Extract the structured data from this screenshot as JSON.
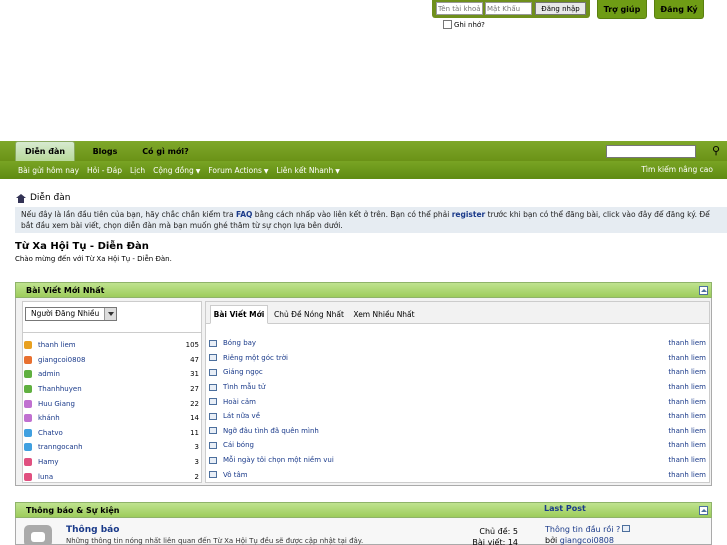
{
  "login": {
    "username_placeholder": "Tên tài khoả",
    "password_placeholder": "Mật Khẩu",
    "login_button": "Đăng nhập",
    "remember": "Ghi nhớ?"
  },
  "top_buttons": {
    "help": "Trợ giúp",
    "register": "Đăng Ký"
  },
  "nav": {
    "tabs": [
      "Diễn đàn",
      "Blogs",
      "Có gì mới?"
    ],
    "sub": [
      "Bài gửi hôm nay",
      "Hỏi - Đáp",
      "Lịch",
      "Cộng đồng",
      "Forum Actions",
      "Liên kết Nhanh"
    ],
    "advanced_search": "Tìm kiếm nâng cao"
  },
  "breadcrumb": "Diễn đàn",
  "notice": {
    "part1": "Nếu đây là lần đầu tiên của bạn, hãy chắc chắn kiểm tra ",
    "faq": "FAQ",
    "part2": " bằng cách nhấp vào liên kết ở trên. Bạn có thể phải ",
    "register": "register",
    "part3": " trước khi bạn có thể đăng bài, click vào đây để đăng ký. Để bắt đầu xem bài viết, chọn diễn đàn mà bạn muốn ghé thăm từ sự chọn lựa bên dưới."
  },
  "page": {
    "title": "Từ Xa Hội Tụ - Diễn Đàn",
    "description": "Chào mừng đến với Từ Xa Hội Tụ - Diễn Đàn."
  },
  "latest": {
    "heading": "Bài Viết Mới Nhất",
    "poster_select": "Người Đăng Nhiều",
    "posters": [
      {
        "name": "thanh liem",
        "count": "105",
        "color": "#e8a020"
      },
      {
        "name": "giangcoi0808",
        "count": "47",
        "color": "#e87030"
      },
      {
        "name": "admin",
        "count": "31",
        "color": "#60b040"
      },
      {
        "name": "Thanhhuyen",
        "count": "27",
        "color": "#60b040"
      },
      {
        "name": "Huu Giang",
        "count": "22",
        "color": "#c070d0"
      },
      {
        "name": "khánh",
        "count": "14",
        "color": "#c070d0"
      },
      {
        "name": "Chatvo",
        "count": "11",
        "color": "#40a0e0"
      },
      {
        "name": "tranngocanh",
        "count": "3",
        "color": "#40a0e0"
      },
      {
        "name": "Hamy",
        "count": "3",
        "color": "#e05080"
      },
      {
        "name": "luna",
        "count": "2",
        "color": "#e05080"
      }
    ],
    "tabs": [
      "Bài Viết Mới",
      "Chủ Đề Nóng Nhất",
      "Xem Nhiều Nhất"
    ],
    "threads": [
      {
        "title": "Bóng bay",
        "author": "thanh liem"
      },
      {
        "title": "Riêng một góc trời",
        "author": "thanh liem"
      },
      {
        "title": "Giáng ngọc",
        "author": "thanh liem"
      },
      {
        "title": "Tình mẫu tử",
        "author": "thanh liem"
      },
      {
        "title": "Hoài cảm",
        "author": "thanh liem"
      },
      {
        "title": "Lát nữa về",
        "author": "thanh liem"
      },
      {
        "title": "Ngỡ đâu tình đã quên mình",
        "author": "thanh liem"
      },
      {
        "title": "Cái bóng",
        "author": "thanh liem"
      },
      {
        "title": "Mỗi ngày tôi chọn một niềm vui",
        "author": "thanh liem"
      },
      {
        "title": "Vô tâm",
        "author": "thanh liem"
      }
    ]
  },
  "forum_block": {
    "heading": "Thông báo & Sự kiện",
    "last_post_label": "Last Post",
    "forum_title": "Thông báo",
    "forum_desc": "Những thông tin nóng nhất liên quan đến Từ Xa Hội Tụ đều sẽ được cập nhật tại đây.",
    "threads_stat": "Chủ đề: 5",
    "posts_stat": "Bài viết: 14",
    "last_post_title": "Thông tin đầu rồi ?",
    "last_post_by": "bởi ",
    "last_post_user": "giangcoi0808"
  }
}
